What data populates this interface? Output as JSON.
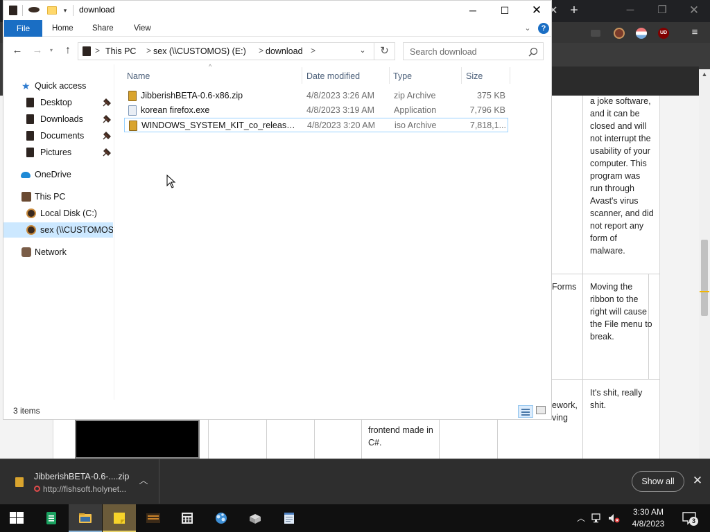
{
  "explorer": {
    "title": "download",
    "window_controls": {
      "minimize": "─",
      "maximize": "☐",
      "close": "✕"
    },
    "ribbon": {
      "tabs": [
        {
          "label": "File",
          "active": true
        },
        {
          "label": "Home"
        },
        {
          "label": "Share"
        },
        {
          "label": "View"
        }
      ]
    },
    "address": {
      "breadcrumb": [
        "This PC",
        "sex (\\\\CUSTOMOS) (E:)",
        "download"
      ],
      "separator": ">"
    },
    "search": {
      "placeholder": "Search download"
    },
    "navpane": {
      "items": [
        {
          "label": "Quick access",
          "icon": "star-icon",
          "pinned": false
        },
        {
          "label": "Desktop",
          "icon": "folder-icon",
          "pinned": true
        },
        {
          "label": "Downloads",
          "icon": "folder-icon",
          "pinned": true
        },
        {
          "label": "Documents",
          "icon": "folder-icon",
          "pinned": true
        },
        {
          "label": "Pictures",
          "icon": "folder-icon",
          "pinned": true
        },
        {
          "label": "OneDrive",
          "icon": "cloud-icon",
          "pinned": false
        },
        {
          "label": "This PC",
          "icon": "computer-icon",
          "pinned": false
        },
        {
          "label": "Local Disk (C:)",
          "icon": "disk-icon",
          "pinned": false
        },
        {
          "label": "sex (\\\\CUSTOMOS) (E:)",
          "icon": "network-drive-icon",
          "pinned": false,
          "selected": true
        },
        {
          "label": "Network",
          "icon": "network-icon",
          "pinned": false
        }
      ]
    },
    "filelist": {
      "columns": [
        "Name",
        "Date modified",
        "Type",
        "Size"
      ],
      "rows": [
        {
          "name": "JibberishBETA-0.6-x86.zip",
          "date": "4/8/2023 3:26 AM",
          "type": "zip Archive",
          "size": "375 KB",
          "icon": "zip-icon"
        },
        {
          "name": "korean firefox.exe",
          "date": "4/8/2023 3:19 AM",
          "type": "Application",
          "size": "7,796 KB",
          "icon": "exe-icon"
        },
        {
          "name": "WINDOWS_SYSTEM_KIT_co_release.iso",
          "date": "4/8/2023 3:20 AM",
          "type": "iso Archive",
          "size": "7,818,1...",
          "icon": "iso-icon",
          "selected": true
        }
      ]
    },
    "status": {
      "item_count": "3 items"
    }
  },
  "browser": {
    "page_text": {
      "cell_joke": "a joke software, and it can be closed and will not interrupt the usability of your computer. This program was run through Avast's virus scanner, and did not report any form of malware.",
      "cell_ribbon": "Moving the ribbon to the right will cause the File menu to break.",
      "cell_shit": "It's shit, really shit.",
      "cell_forms": "Forms",
      "cell_framework": "ework, ving",
      "cell_frontend": "frontend made in C#."
    },
    "extensions": {
      "ublock": "UD"
    },
    "menu_icon": "≡",
    "new_tab": "+",
    "tab_close": "✕"
  },
  "downloads": {
    "item": {
      "filename": "JibberishBETA-0.6-....zip",
      "url": "http://fishsoft.holynet..."
    },
    "show_all": "Show all",
    "close": "✕"
  },
  "taskbar": {
    "apps": [
      {
        "name": "spreadsheets",
        "icon": "spreadsheet-app-icon"
      },
      {
        "name": "file-explorer",
        "icon": "folder-app-icon",
        "active": true
      },
      {
        "name": "sticky-notes",
        "icon": "sticky-notes-icon",
        "highlight": true
      },
      {
        "name": "media-player",
        "icon": "media-app-icon"
      },
      {
        "name": "calculator",
        "icon": "calculator-icon"
      },
      {
        "name": "network-app",
        "icon": "network-app-icon"
      },
      {
        "name": "installer",
        "icon": "installer-icon"
      },
      {
        "name": "notepad",
        "icon": "notepad-icon"
      }
    ],
    "clock": {
      "time": "3:30 AM",
      "date": "4/8/2023"
    },
    "notifications": {
      "count": "3"
    }
  },
  "colors": {
    "accent": "#1a6ec4",
    "selection": "#cce8ff",
    "selection_border": "#99d1ff"
  }
}
